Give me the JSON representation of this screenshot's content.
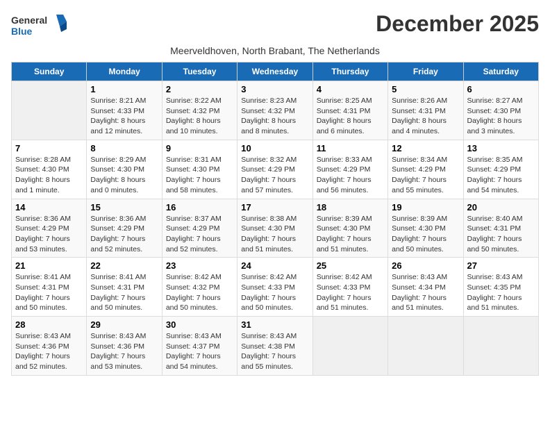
{
  "header": {
    "logo_general": "General",
    "logo_blue": "Blue",
    "title": "December 2025",
    "subtitle": "Meerveldhoven, North Brabant, The Netherlands"
  },
  "days_of_week": [
    "Sunday",
    "Monday",
    "Tuesday",
    "Wednesday",
    "Thursday",
    "Friday",
    "Saturday"
  ],
  "weeks": [
    [
      {
        "day": "",
        "info": ""
      },
      {
        "day": "1",
        "info": "Sunrise: 8:21 AM\nSunset: 4:33 PM\nDaylight: 8 hours\nand 12 minutes."
      },
      {
        "day": "2",
        "info": "Sunrise: 8:22 AM\nSunset: 4:32 PM\nDaylight: 8 hours\nand 10 minutes."
      },
      {
        "day": "3",
        "info": "Sunrise: 8:23 AM\nSunset: 4:32 PM\nDaylight: 8 hours\nand 8 minutes."
      },
      {
        "day": "4",
        "info": "Sunrise: 8:25 AM\nSunset: 4:31 PM\nDaylight: 8 hours\nand 6 minutes."
      },
      {
        "day": "5",
        "info": "Sunrise: 8:26 AM\nSunset: 4:31 PM\nDaylight: 8 hours\nand 4 minutes."
      },
      {
        "day": "6",
        "info": "Sunrise: 8:27 AM\nSunset: 4:30 PM\nDaylight: 8 hours\nand 3 minutes."
      }
    ],
    [
      {
        "day": "7",
        "info": "Sunrise: 8:28 AM\nSunset: 4:30 PM\nDaylight: 8 hours\nand 1 minute."
      },
      {
        "day": "8",
        "info": "Sunrise: 8:29 AM\nSunset: 4:30 PM\nDaylight: 8 hours\nand 0 minutes."
      },
      {
        "day": "9",
        "info": "Sunrise: 8:31 AM\nSunset: 4:30 PM\nDaylight: 7 hours\nand 58 minutes."
      },
      {
        "day": "10",
        "info": "Sunrise: 8:32 AM\nSunset: 4:29 PM\nDaylight: 7 hours\nand 57 minutes."
      },
      {
        "day": "11",
        "info": "Sunrise: 8:33 AM\nSunset: 4:29 PM\nDaylight: 7 hours\nand 56 minutes."
      },
      {
        "day": "12",
        "info": "Sunrise: 8:34 AM\nSunset: 4:29 PM\nDaylight: 7 hours\nand 55 minutes."
      },
      {
        "day": "13",
        "info": "Sunrise: 8:35 AM\nSunset: 4:29 PM\nDaylight: 7 hours\nand 54 minutes."
      }
    ],
    [
      {
        "day": "14",
        "info": "Sunrise: 8:36 AM\nSunset: 4:29 PM\nDaylight: 7 hours\nand 53 minutes."
      },
      {
        "day": "15",
        "info": "Sunrise: 8:36 AM\nSunset: 4:29 PM\nDaylight: 7 hours\nand 52 minutes."
      },
      {
        "day": "16",
        "info": "Sunrise: 8:37 AM\nSunset: 4:29 PM\nDaylight: 7 hours\nand 52 minutes."
      },
      {
        "day": "17",
        "info": "Sunrise: 8:38 AM\nSunset: 4:30 PM\nDaylight: 7 hours\nand 51 minutes."
      },
      {
        "day": "18",
        "info": "Sunrise: 8:39 AM\nSunset: 4:30 PM\nDaylight: 7 hours\nand 51 minutes."
      },
      {
        "day": "19",
        "info": "Sunrise: 8:39 AM\nSunset: 4:30 PM\nDaylight: 7 hours\nand 50 minutes."
      },
      {
        "day": "20",
        "info": "Sunrise: 8:40 AM\nSunset: 4:31 PM\nDaylight: 7 hours\nand 50 minutes."
      }
    ],
    [
      {
        "day": "21",
        "info": "Sunrise: 8:41 AM\nSunset: 4:31 PM\nDaylight: 7 hours\nand 50 minutes."
      },
      {
        "day": "22",
        "info": "Sunrise: 8:41 AM\nSunset: 4:31 PM\nDaylight: 7 hours\nand 50 minutes."
      },
      {
        "day": "23",
        "info": "Sunrise: 8:42 AM\nSunset: 4:32 PM\nDaylight: 7 hours\nand 50 minutes."
      },
      {
        "day": "24",
        "info": "Sunrise: 8:42 AM\nSunset: 4:33 PM\nDaylight: 7 hours\nand 50 minutes."
      },
      {
        "day": "25",
        "info": "Sunrise: 8:42 AM\nSunset: 4:33 PM\nDaylight: 7 hours\nand 51 minutes."
      },
      {
        "day": "26",
        "info": "Sunrise: 8:43 AM\nSunset: 4:34 PM\nDaylight: 7 hours\nand 51 minutes."
      },
      {
        "day": "27",
        "info": "Sunrise: 8:43 AM\nSunset: 4:35 PM\nDaylight: 7 hours\nand 51 minutes."
      }
    ],
    [
      {
        "day": "28",
        "info": "Sunrise: 8:43 AM\nSunset: 4:36 PM\nDaylight: 7 hours\nand 52 minutes."
      },
      {
        "day": "29",
        "info": "Sunrise: 8:43 AM\nSunset: 4:36 PM\nDaylight: 7 hours\nand 53 minutes."
      },
      {
        "day": "30",
        "info": "Sunrise: 8:43 AM\nSunset: 4:37 PM\nDaylight: 7 hours\nand 54 minutes."
      },
      {
        "day": "31",
        "info": "Sunrise: 8:43 AM\nSunset: 4:38 PM\nDaylight: 7 hours\nand 55 minutes."
      },
      {
        "day": "",
        "info": ""
      },
      {
        "day": "",
        "info": ""
      },
      {
        "day": "",
        "info": ""
      }
    ]
  ]
}
